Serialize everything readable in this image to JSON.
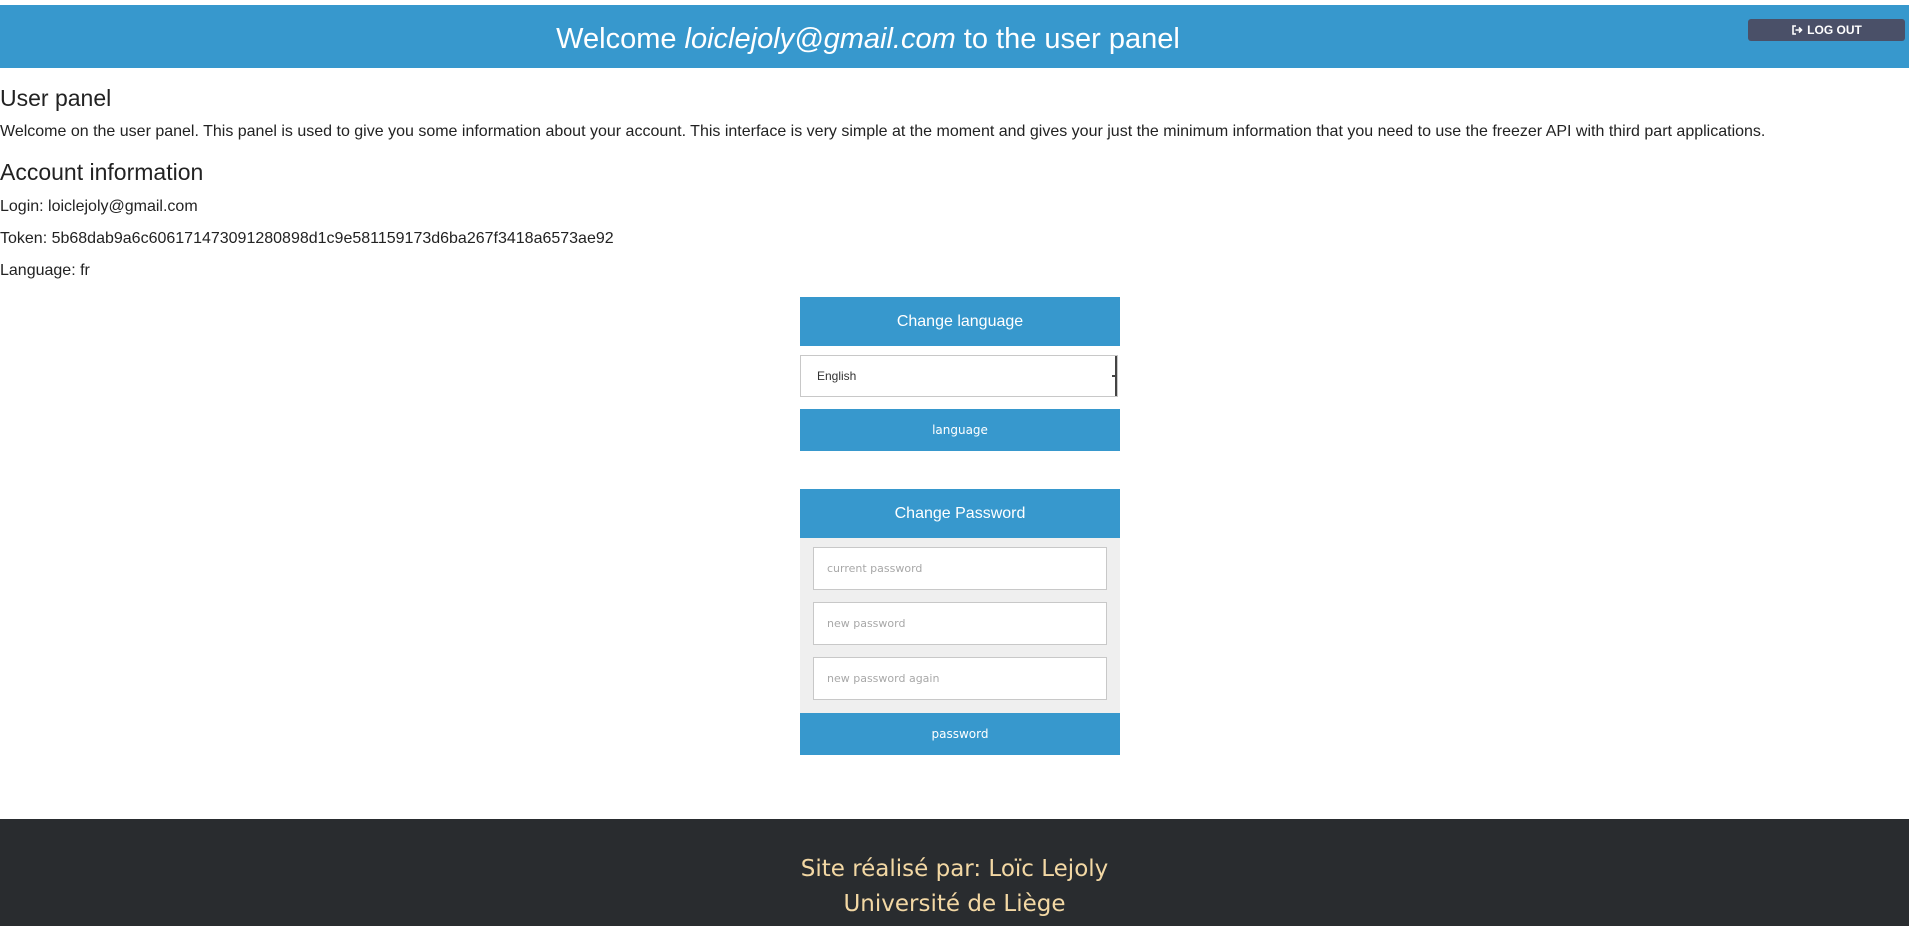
{
  "header": {
    "welcome_prefix": "Welcome ",
    "user_email": "loiclejoly@gmail.com",
    "welcome_suffix": " to the user panel",
    "logout_label": "LOG OUT",
    "logout_icon": "sign-out-icon",
    "background_color": "#3798cd"
  },
  "user_panel": {
    "title": "User panel",
    "intro": "Welcome on the user panel. This panel is used to give you some information about your account. This interface is very simple at the moment and gives your just the minimum information that you need to use the freezer API with third part applications."
  },
  "account": {
    "title": "Account information",
    "login": "Login: loiclejoly@gmail.com",
    "token": "Token: 5b68dab9a6c606171473091280898d1c9e581159173d6ba267f3418a6573ae92",
    "language": "Language: fr"
  },
  "change_language": {
    "title": "Change language",
    "selected": "English",
    "submit_label": "language"
  },
  "change_password": {
    "title": "Change Password",
    "current_placeholder": "current password",
    "new_placeholder": "new password",
    "confirm_placeholder": "new password again",
    "submit_label": "password"
  },
  "footer": {
    "line1": "Site réalisé par: Loïc Lejoly",
    "line2": "Université de Liège",
    "text_color": "#f3d8a4",
    "background_color": "#292c2f"
  }
}
